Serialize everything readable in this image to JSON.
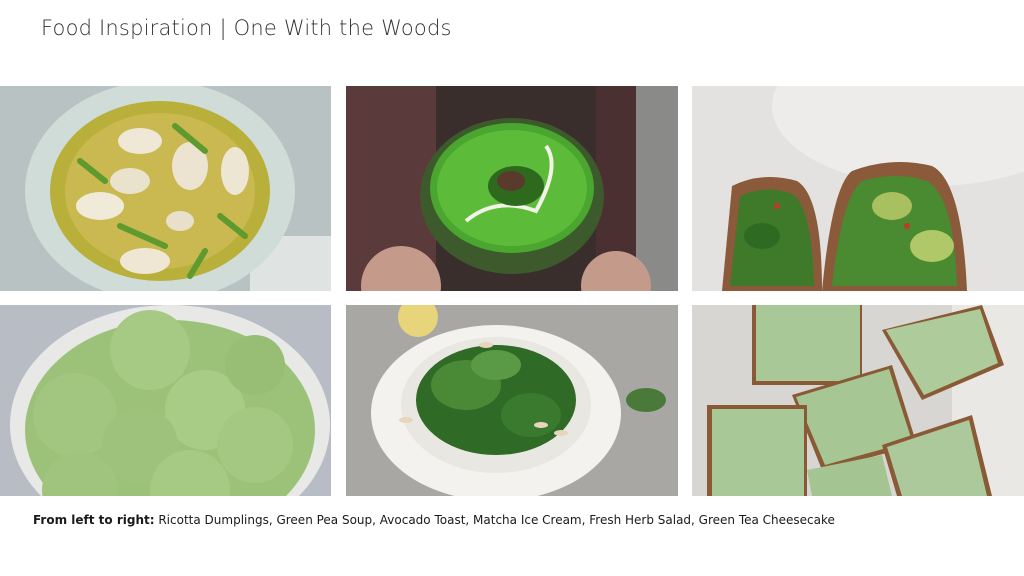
{
  "slide": {
    "title": "Food Inspiration | One With the Woods",
    "caption_label": "From left to right:",
    "caption_text": " Ricotta Dumplings, Green Pea Soup, Avocado Toast, Matcha Ice Cream, Fresh Herb Salad, Green Tea Cheesecake"
  },
  "colors": {
    "background": "#ffffff",
    "title_text": "#333333",
    "matcha_green": "#9cc27a",
    "pea_green": "#3f9a2a"
  },
  "photos": [
    {
      "id": "ricotta-dumplings-photo"
    },
    {
      "id": "green-pea-soup-photo"
    },
    {
      "id": "avocado-toast-photo"
    },
    {
      "id": "matcha-ice-cream-photo"
    },
    {
      "id": "fresh-herb-salad-photo"
    },
    {
      "id": "green-tea-cheesecake-photo"
    }
  ]
}
